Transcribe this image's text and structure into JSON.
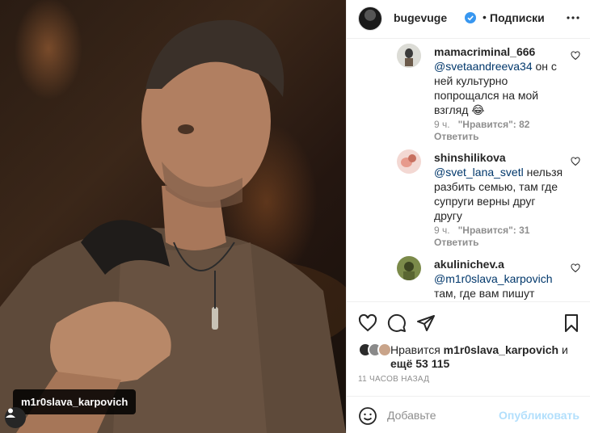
{
  "post": {
    "photo_tag": "m1r0slava_karpovich"
  },
  "header": {
    "username": "bugevuge",
    "separator": "•",
    "follow_status": "Подписки"
  },
  "comments": [
    {
      "username": "mamacriminal_666",
      "mention": "@svetaandreeva34",
      "text": " он с ней культурно попрощался на мой взгляд 😂",
      "time": "9 ч.",
      "likes": "\"Нравится\": 82",
      "reply": "Ответить"
    },
    {
      "username": "shinshilikova",
      "mention": "@svet_lana_svetl",
      "text": " нельзя разбить семью, там где супруги верны друг другу",
      "time": "9 ч.",
      "likes": "\"Нравится\": 31",
      "reply": "Ответить"
    },
    {
      "username": "akulinichev.a",
      "mention": "@m1r0slava_karpovich",
      "text": " там, где вам пишут"
    }
  ],
  "likes": {
    "prefix": "Нравится ",
    "user": "m1r0slava_karpovich",
    "middle": " и",
    "others": "ещё 53 115"
  },
  "time_ago": "11 ЧАСОВ НАЗАД",
  "add_comment": {
    "placeholder": "Добавьте",
    "publish_label": "Опубликовать"
  },
  "colors": {
    "link": "#00376b",
    "verified": "#3897f0",
    "publish_disabled": "#b2dffc",
    "meta": "#8e8e8e"
  }
}
